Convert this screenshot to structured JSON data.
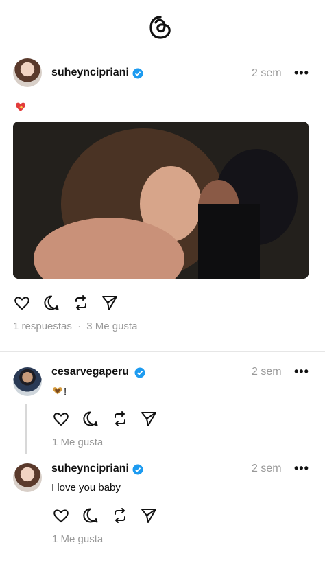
{
  "app": {
    "logo_icon": "threads-logo-icon"
  },
  "posts": [
    {
      "username": "suheyncipriani",
      "verified": true,
      "time": "2 sem",
      "emoji_icon": "sparkling-heart-icon",
      "image_desc_icon": "photo-couple",
      "replies": "1 respuestas",
      "separator": "·",
      "likes": "3 Me gusta"
    },
    {
      "username": "cesarvegaperu",
      "verified": true,
      "time": "2 sem",
      "text": "!",
      "emoji_icon": "heart-hands-icon",
      "likes": "1 Me gusta"
    },
    {
      "username": "suheyncipriani",
      "verified": true,
      "time": "2 sem",
      "text": "I love you baby",
      "likes": "1 Me gusta"
    }
  ],
  "colors": {
    "verified_blue": "#1d9bf0",
    "muted": "#999999",
    "heart_red": "#e23b3b"
  }
}
